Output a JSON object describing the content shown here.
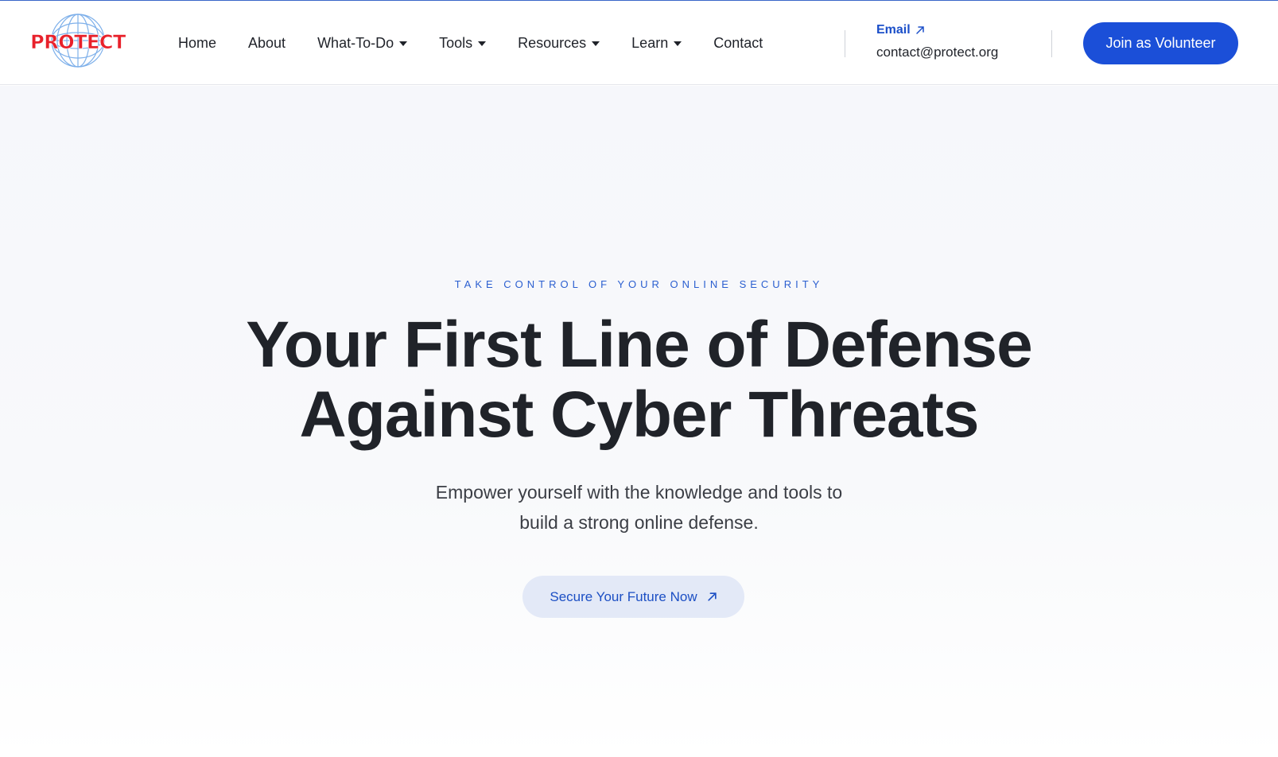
{
  "brand": {
    "logo_text": "PROTECT"
  },
  "nav": {
    "items": [
      {
        "label": "Home",
        "dropdown": false
      },
      {
        "label": "About",
        "dropdown": false
      },
      {
        "label": "What-To-Do",
        "dropdown": true
      },
      {
        "label": "Tools",
        "dropdown": true
      },
      {
        "label": "Resources",
        "dropdown": true
      },
      {
        "label": "Learn",
        "dropdown": true
      },
      {
        "label": "Contact",
        "dropdown": false
      }
    ]
  },
  "contact": {
    "email_label": "Email",
    "email_value": "contact@protect.org",
    "email_icon": "arrow-up-right-icon"
  },
  "header_cta": {
    "label": "Join as Volunteer"
  },
  "hero": {
    "eyebrow": "TAKE CONTROL OF YOUR ONLINE SECURITY",
    "headline_line1": "Your First Line of Defense",
    "headline_line2": "Against Cyber Threats",
    "subtext_line1": "Empower yourself with the knowledge and tools to",
    "subtext_line2": "build a strong online defense.",
    "button_label": "Secure Your Future Now",
    "button_icon": "arrow-up-right-icon"
  },
  "colors": {
    "accent": "#1b4fd8",
    "logo_red": "#e8212b",
    "logo_globe": "#6ea6e6",
    "hero_bg": "#f6f7fb",
    "hero_button_bg": "#e3e9f7"
  }
}
